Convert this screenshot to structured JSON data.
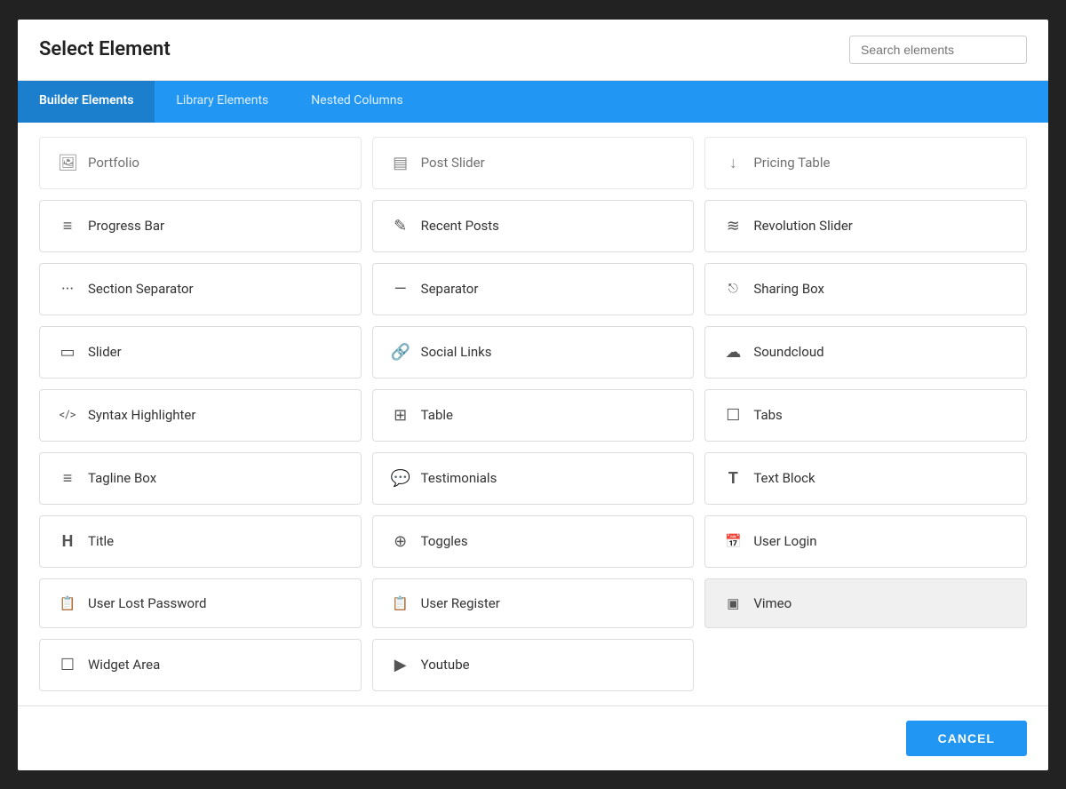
{
  "modal": {
    "title": "Select Element",
    "search_placeholder": "Search elements"
  },
  "tabs": [
    {
      "id": "builder",
      "label": "Builder Elements",
      "active": true
    },
    {
      "id": "library",
      "label": "Library Elements",
      "active": false
    },
    {
      "id": "nested",
      "label": "Nested Columns",
      "active": false
    }
  ],
  "footer": {
    "cancel_label": "CANCEL"
  },
  "elements_partial": [
    {
      "id": "portfolio",
      "label": "Portfolio",
      "icon": "🖼",
      "col": 0
    },
    {
      "id": "post-slider",
      "label": "Post Slider",
      "icon": "▤",
      "col": 1
    },
    {
      "id": "pricing-table",
      "label": "Pricing Table",
      "icon": "↓",
      "col": 2
    }
  ],
  "elements": [
    {
      "id": "progress-bar",
      "label": "Progress Bar",
      "icon": "≡",
      "col": 0
    },
    {
      "id": "recent-posts",
      "label": "Recent Posts",
      "icon": "✎",
      "col": 1
    },
    {
      "id": "revolution-slider",
      "label": "Revolution Slider",
      "icon": "≋",
      "col": 2
    },
    {
      "id": "section-separator",
      "label": "Section Separator",
      "icon": "···",
      "col": 0
    },
    {
      "id": "separator",
      "label": "Separator",
      "icon": "—",
      "col": 1
    },
    {
      "id": "sharing-box",
      "label": "Sharing Box",
      "icon": "⎋",
      "col": 2
    },
    {
      "id": "slider",
      "label": "Slider",
      "icon": "▭",
      "col": 0
    },
    {
      "id": "social-links",
      "label": "Social Links",
      "icon": "🔗",
      "col": 1
    },
    {
      "id": "soundcloud",
      "label": "Soundcloud",
      "icon": "☁",
      "col": 2
    },
    {
      "id": "syntax-highlighter",
      "label": "Syntax Highlighter",
      "icon": "</>",
      "col": 0
    },
    {
      "id": "table",
      "label": "Table",
      "icon": "⊞",
      "col": 1
    },
    {
      "id": "tabs",
      "label": "Tabs",
      "icon": "☐",
      "col": 2
    },
    {
      "id": "tagline-box",
      "label": "Tagline Box",
      "icon": "≡",
      "col": 0
    },
    {
      "id": "testimonials",
      "label": "Testimonials",
      "icon": "💬",
      "col": 1
    },
    {
      "id": "text-block",
      "label": "Text Block",
      "icon": "T",
      "col": 2
    },
    {
      "id": "title",
      "label": "Title",
      "icon": "H",
      "col": 0
    },
    {
      "id": "toggles",
      "label": "Toggles",
      "icon": "⊕",
      "col": 1
    },
    {
      "id": "user-login",
      "label": "User Login",
      "icon": "📅",
      "col": 2
    },
    {
      "id": "user-lost-password",
      "label": "User Lost Password",
      "icon": "📋",
      "col": 0
    },
    {
      "id": "user-register",
      "label": "User Register",
      "icon": "📋",
      "col": 1
    },
    {
      "id": "vimeo",
      "label": "Vimeo",
      "icon": "▣",
      "col": 2,
      "highlighted": true
    },
    {
      "id": "widget-area",
      "label": "Widget Area",
      "icon": "☐",
      "col": 0
    },
    {
      "id": "youtube",
      "label": "Youtube",
      "icon": "▶",
      "col": 1
    }
  ]
}
